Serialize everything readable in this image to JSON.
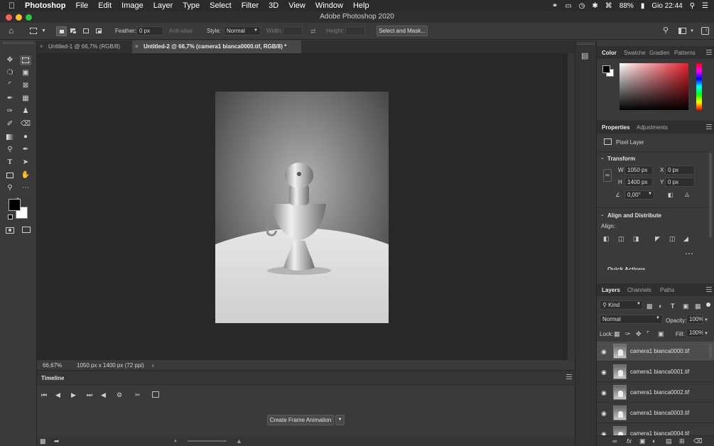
{
  "menubar": {
    "apple": "",
    "app_name": "Photoshop",
    "items": [
      "File",
      "Edit",
      "Image",
      "Layer",
      "Type",
      "Select",
      "Filter",
      "3D",
      "View",
      "Window",
      "Help"
    ],
    "battery": "88%",
    "clock": "Gio 22:44"
  },
  "window": {
    "title": "Adobe Photoshop 2020"
  },
  "options": {
    "feather_label": "Feather:",
    "feather_value": "0 px",
    "antialias_label": "Anti-alias",
    "style_label": "Style:",
    "style_value": "Normal",
    "width_label": "Width:",
    "height_label": "Height:",
    "select_mask_button": "Select and Mask..."
  },
  "tabs": [
    {
      "label": "Untitled-1 @ 66,7% (RGB/8)"
    },
    {
      "label": "Untitled-2 @ 66,7% (camera1 bianca0000.tif, RGB/8) *"
    }
  ],
  "status": {
    "zoom": "66,67%",
    "doc_info": "1050 px x 1400 px (72 ppi)"
  },
  "timeline": {
    "title": "Timeline",
    "create_button": "Create Frame Animation"
  },
  "color_panel": {
    "tabs": [
      "Color",
      "Swatche",
      "Gradien",
      "Patterns"
    ]
  },
  "properties_panel": {
    "tabs": [
      "Properties",
      "Adjustments"
    ],
    "pixel_layer": "Pixel Layer",
    "transform_title": "Transform",
    "w_label": "W",
    "w_value": "1050 px",
    "h_label": "H",
    "h_value": "1400 px",
    "x_label": "X",
    "x_value": "0 px",
    "y_label": "Y",
    "y_value": "0 px",
    "angle_value": "0,00°",
    "align_title": "Align and Distribute",
    "align_label": "Align:",
    "quick_actions": "Quick Actions"
  },
  "layers_panel": {
    "tabs": [
      "Layers",
      "Channels",
      "Paths"
    ],
    "kind": "Kind",
    "blend_mode": "Normal",
    "opacity_label": "Opacity:",
    "opacity_value": "100%",
    "lock_label": "Lock:",
    "fill_label": "Fill:",
    "fill_value": "100%",
    "layers": [
      {
        "name": "camera1 bianca0000.tif"
      },
      {
        "name": "camera1 bianca0001.tif"
      },
      {
        "name": "camera1 bianca0002.tif"
      },
      {
        "name": "camera1 bianca0003.tif"
      },
      {
        "name": "camera1 bianca0004.tif"
      }
    ]
  },
  "colors": {
    "accent": "#1473e6",
    "canvas_bg": "#282828",
    "panel_bg": "#3a3a3a"
  }
}
